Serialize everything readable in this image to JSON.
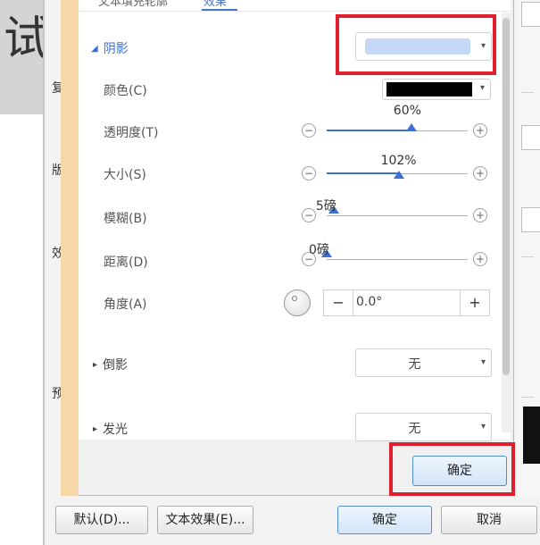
{
  "background": {
    "partial_char": "试"
  },
  "outer_dialog": {
    "side_labels": [
      "复",
      "版",
      "效",
      "预"
    ],
    "buttons": {
      "default": "默认(D)...",
      "text_effect": "文本效果(E)...",
      "ok": "确定",
      "cancel": "取消"
    }
  },
  "inner_dialog": {
    "tabs": {
      "fill_outline": "文本填充轮廓",
      "effects": "效果"
    },
    "shadow": {
      "title": "阴影",
      "preset_color": "#c5d9f6",
      "color_label": "颜色(C)",
      "color_value": "#000000",
      "transparency": {
        "label": "透明度(T)",
        "value_text": "60%",
        "value": 60,
        "max": 100
      },
      "size": {
        "label": "大小(S)",
        "value_text": "102%",
        "value": 102,
        "max": 200
      },
      "blur": {
        "label": "模糊(B)",
        "value_text": "5磅",
        "value": 5,
        "max": 100
      },
      "distance": {
        "label": "距离(D)",
        "value_text": "0磅",
        "value": 0,
        "max": 100
      },
      "angle": {
        "label": "角度(A)",
        "value": "0.0°",
        "minus": "−",
        "plus": "+"
      }
    },
    "reflection": {
      "title": "倒影",
      "value": "无"
    },
    "glow": {
      "title": "发光",
      "value": "无"
    },
    "ok_button": "确定"
  },
  "colors": {
    "accent": "#3b6fd6",
    "highlight": "#e0202d"
  }
}
